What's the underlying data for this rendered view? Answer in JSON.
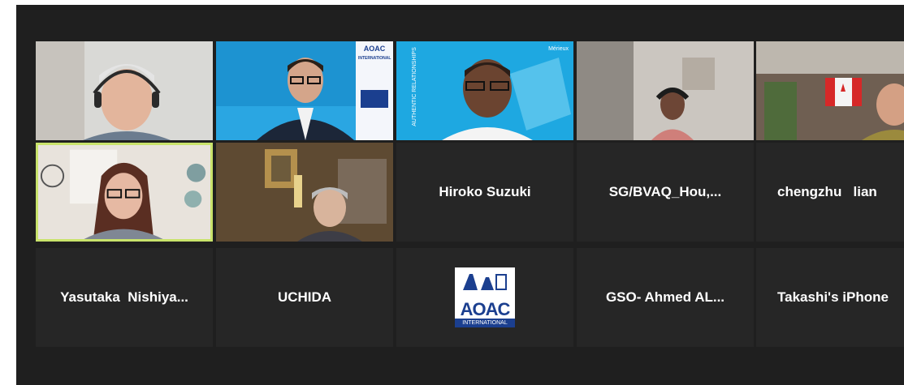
{
  "participants": {
    "row2": {
      "tile3": {
        "name": "Hiroko Suzuki"
      },
      "tile4": {
        "name": "SG/BVAQ_Hou,..."
      },
      "tile5": {
        "name": "chengzhu   lian"
      }
    },
    "row3": {
      "tile1": {
        "name": "Yasutaka  Nishiya..."
      },
      "tile2": {
        "name": "UCHIDA"
      },
      "tile3": {
        "logo_text_top": "AOAC",
        "logo_text_bottom": "INTERNATIONAL"
      },
      "tile4": {
        "name": "GSO- Ahmed AL..."
      },
      "tile5": {
        "name": "Takashi's iPhone"
      }
    }
  },
  "video_badges": {
    "aoac_banner_top": "AOAC",
    "aoac_banner_sub": "INTERNATIONAL",
    "vertical_caption": "AUTHENTIC RELATIONSHIPS",
    "brand_small": "Mérieux"
  },
  "colors": {
    "background": "#1f1f1f",
    "tile": "#262626",
    "active_speaker_border": "#c9e36b",
    "aoac_blue": "#1b3f8f"
  }
}
